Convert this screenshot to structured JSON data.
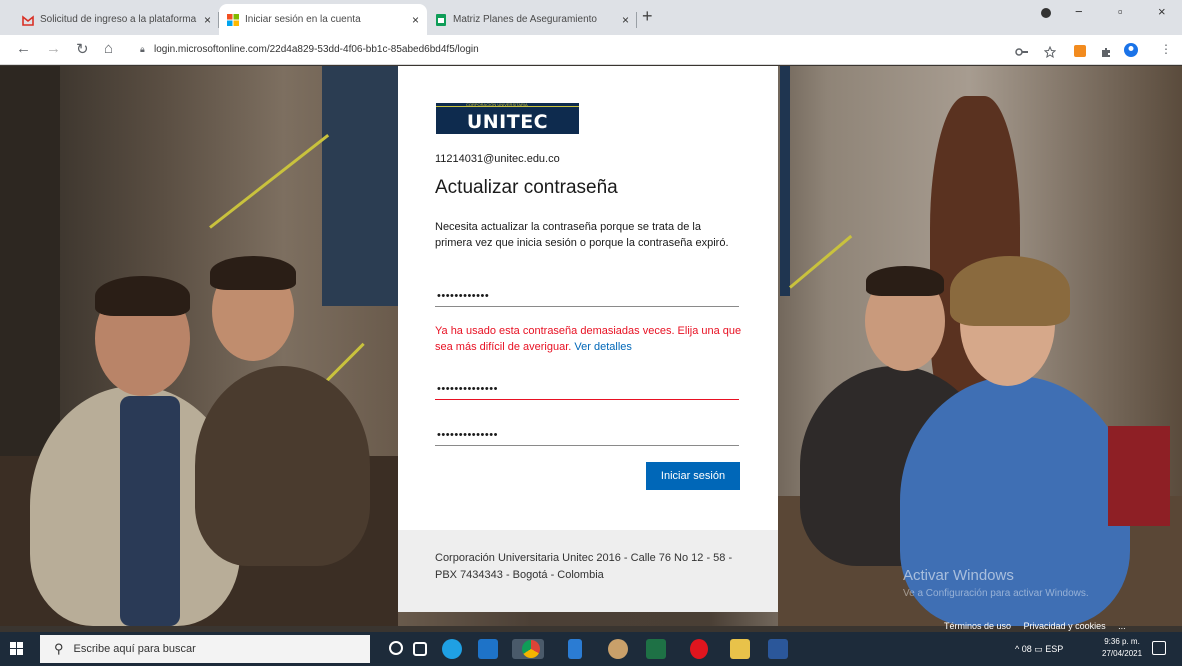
{
  "browser": {
    "tabs": [
      {
        "title": "Solicitud de ingreso a la plataforma",
        "favicon_color": "#d93025"
      },
      {
        "title": "Iniciar sesión en la cuenta",
        "favicon_color": "#f25022"
      },
      {
        "title": "Matriz Planes de Aseguramiento",
        "favicon_color": "#0f9d58"
      }
    ],
    "close_glyph": "×",
    "new_tab_glyph": "+",
    "url": "login.microsoftonline.com/22d4a829-53dd-4f06-bb1c-85abed6bd4f5/login",
    "window": {
      "minimize": "−",
      "maximize": "▫",
      "close": "×"
    }
  },
  "card": {
    "logo_tagline": "CORPORACIÓN UNIVERSITARIA",
    "logo_text": "UNITEC",
    "email": "11214031@unitec.edu.co",
    "title": "Actualizar contraseña",
    "description": "Necesita actualizar la contraseña porque se trata de la primera vez que inicia sesión o porque la contraseña expiró.",
    "current_password_mask": "••••••••••••",
    "error_text": "Ya ha usado esta contraseña demasiadas veces. Elija una que sea más difícil de averiguar.",
    "error_link": "Ver detalles",
    "new_password_mask": "••••••••••••••",
    "confirm_password_mask": "••••••••••••••",
    "submit_label": "Iniciar sesión",
    "footer": "Corporación Universitaria Unitec 2016 - Calle 76 No 12 - 58 - PBX 7434343 - Bogotá - Colombia"
  },
  "page": {
    "watermark_title": "Activar Windows",
    "watermark_sub": "Ve a Configuración para activar Windows.",
    "footer_links": [
      "Términos de uso",
      "Privacidad y cookies",
      "..."
    ]
  },
  "taskbar": {
    "search_placeholder": "Escribe aquí para buscar",
    "tray_text": "^ 08 ▭ ESP",
    "time": "9:36 p. m.",
    "date": "27/04/2021"
  },
  "colors": {
    "accent": "#0067b8",
    "error": "#e81123",
    "logo_navy": "#0e2b4e",
    "brand_yellow": "#c9c23d"
  }
}
